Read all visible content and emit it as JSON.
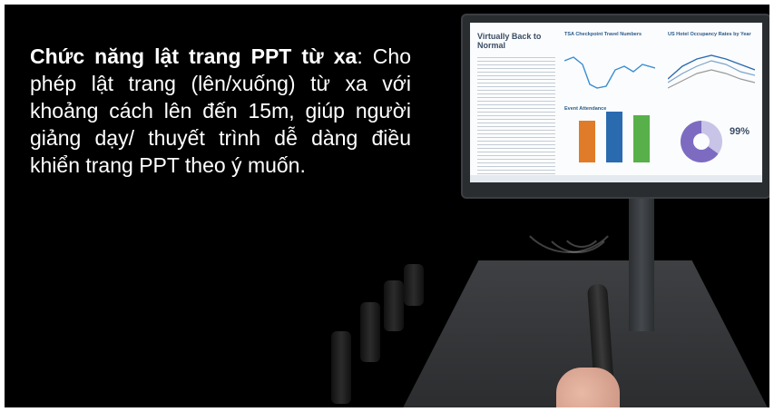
{
  "caption": {
    "title": "Chức năng lật trang PPT từ xa",
    "title_suffix": ":",
    "body": " Cho phép lật trang (lên/xuống) từ xa với khoảng cách lên đến 15m, giúp người giảng dạy/ thuyết trình dễ dàng điều khiển trang PPT theo ý muốn."
  },
  "screen": {
    "title": "Virtually Back to Normal",
    "tsa_title": "TSA Checkpoint Travel Numbers",
    "hotel_title": "US Hotel Occupancy Rates by Year",
    "event_title": "Event Attendance",
    "donut_pct": "99%"
  },
  "colors": {
    "bar_orange": "#e07b2a",
    "bar_blue": "#2a6bb0",
    "bar_green": "#58b04a",
    "line_blue": "#3a8dd0"
  }
}
